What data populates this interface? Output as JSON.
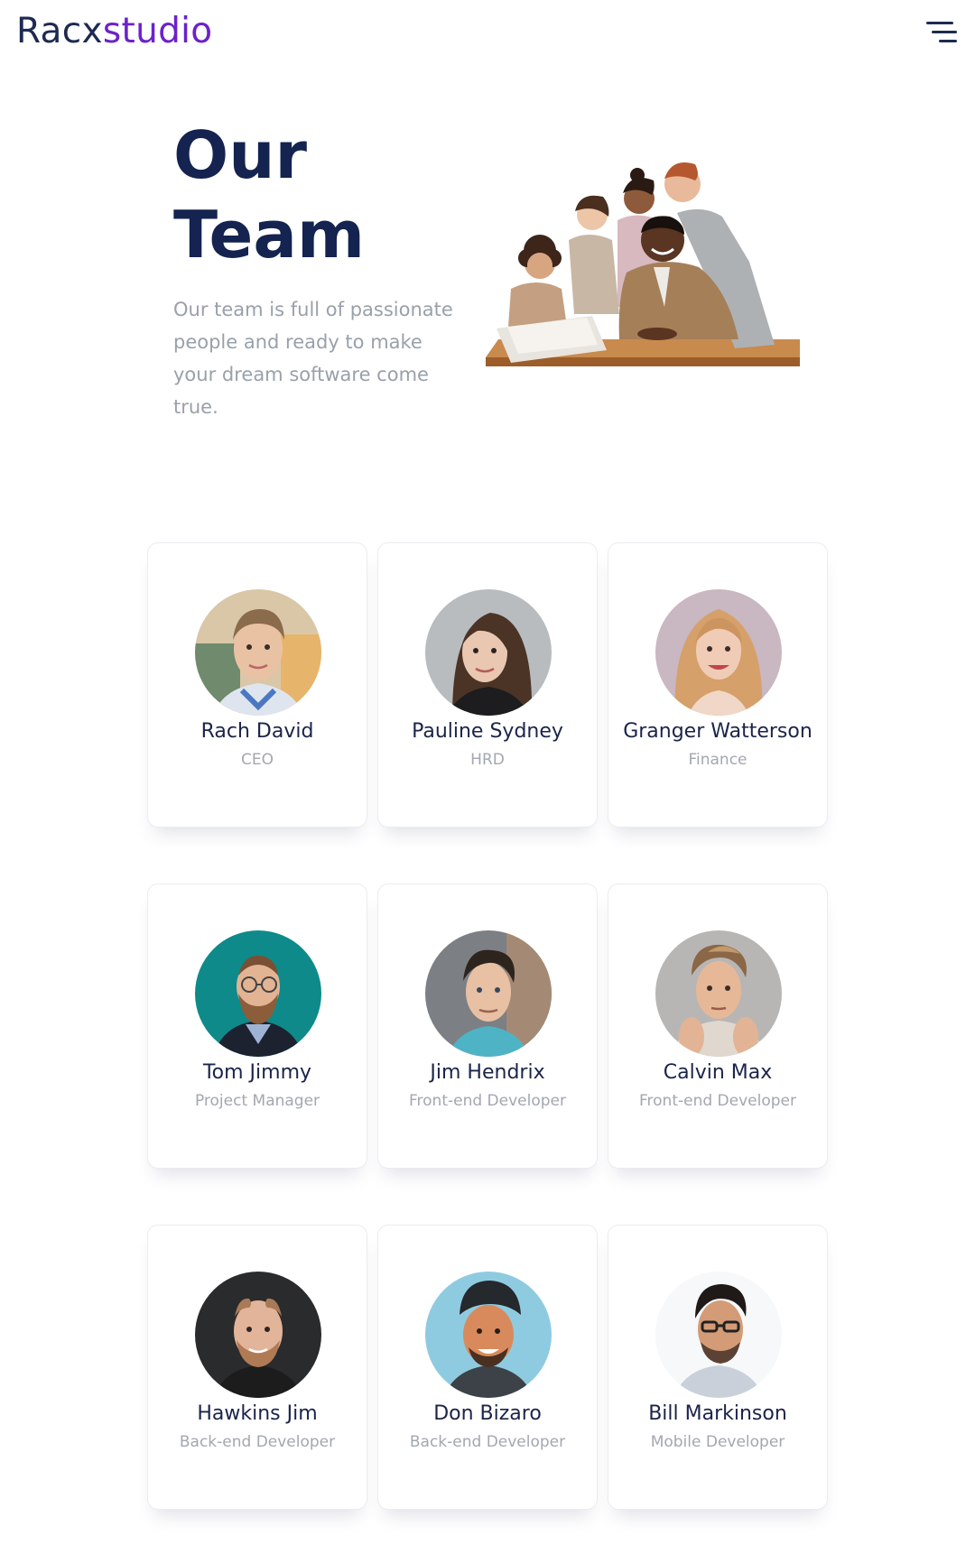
{
  "header": {
    "logo_part1": "Racx",
    "logo_part2": "studio",
    "menu_icon": "hamburger-menu-icon"
  },
  "hero": {
    "title_line1": "Our",
    "title_line2": "Team",
    "description": "Our team is full of passionate people and ready to make your dream software come true."
  },
  "team": [
    {
      "name": "Rach David",
      "role": "CEO"
    },
    {
      "name": "Pauline Sydney",
      "role": "HRD"
    },
    {
      "name": "Granger Watterson",
      "role": "Finance"
    },
    {
      "name": "Tom Jimmy",
      "role": "Project Manager"
    },
    {
      "name": "Jim Hendrix",
      "role": "Front-end Developer"
    },
    {
      "name": "Calvin Max",
      "role": "Front-end Developer"
    },
    {
      "name": "Hawkins Jim",
      "role": "Back-end Developer"
    },
    {
      "name": "Don Bizaro",
      "role": "Back-end Developer"
    },
    {
      "name": "Bill Markinson",
      "role": "Mobile Developer"
    }
  ],
  "colors": {
    "brand_dark": "#1e2a52",
    "brand_purple": "#6c22c9",
    "heading": "#14234f",
    "muted_text": "#9aa0ab"
  }
}
